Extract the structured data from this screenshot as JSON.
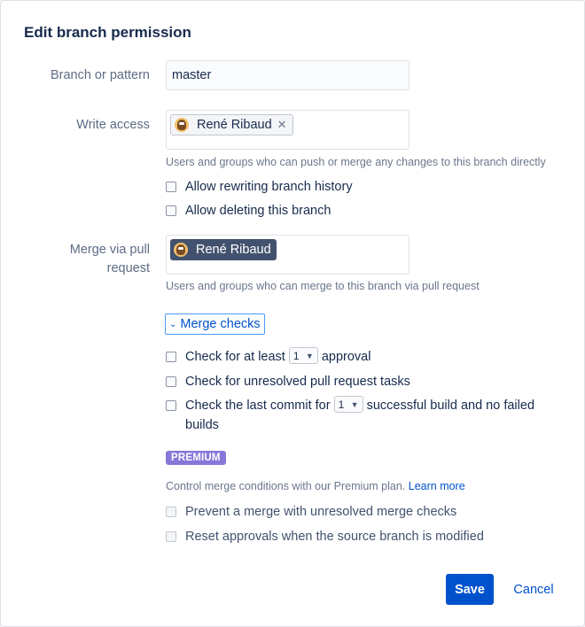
{
  "dialog": {
    "title": "Edit branch permission"
  },
  "branch": {
    "label": "Branch or pattern",
    "value": "master"
  },
  "write_access": {
    "label": "Write access",
    "users": [
      {
        "name": "René Ribaud",
        "avatar_icon": "owl-avatar-icon",
        "remove_icon": "close-icon"
      }
    ],
    "help": "Users and groups who can push or merge any changes to this branch directly",
    "options": [
      {
        "label": "Allow rewriting branch history",
        "checked": false
      },
      {
        "label": "Allow deleting this branch",
        "checked": false
      }
    ]
  },
  "merge_pr": {
    "label_line1": "Merge via pull",
    "label_line2": "request",
    "users": [
      {
        "name": "René Ribaud",
        "avatar_icon": "owl-avatar-icon"
      }
    ],
    "help": "Users and groups who can merge to this branch via pull request"
  },
  "merge_checks": {
    "toggle_label": "Merge checks",
    "toggle_icon": "chevron-down-icon",
    "approval": {
      "prefix": "Check for at least",
      "value": "1",
      "suffix": "approval",
      "checked": false
    },
    "tasks": {
      "label": "Check for unresolved pull request tasks",
      "checked": false
    },
    "builds": {
      "prefix": "Check the last commit for",
      "value": "1",
      "suffix": "successful build and no failed",
      "suffix2": "builds",
      "checked": false
    }
  },
  "premium": {
    "badge": "PREMIUM",
    "badge_color": "#8777d9",
    "description": "Control merge conditions with our Premium plan.",
    "link": "Learn more",
    "options": [
      {
        "label": "Prevent a merge with unresolved merge checks",
        "disabled": true
      },
      {
        "label": "Reset approvals when the source branch is modified",
        "disabled": true
      }
    ]
  },
  "actions": {
    "save": "Save",
    "cancel": "Cancel",
    "primary_color": "#0052cc"
  }
}
